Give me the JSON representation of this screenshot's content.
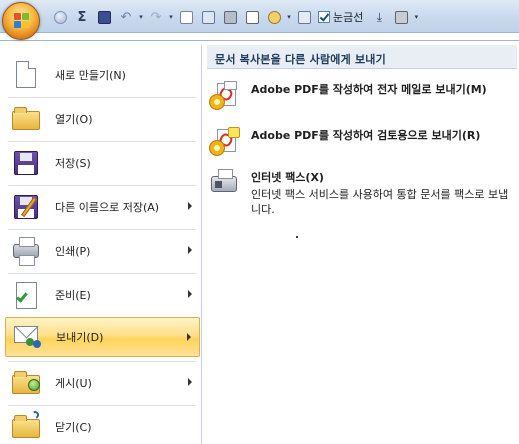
{
  "quick_access": {
    "check_label": "눈금선"
  },
  "menu": {
    "items": [
      {
        "label": "새로 만들기(N)",
        "icon": "new-document-icon"
      },
      {
        "label": "열기(O)",
        "icon": "open-folder-icon"
      },
      {
        "label": "저장(S)",
        "icon": "save-floppy-icon"
      },
      {
        "label": "다른 이름으로 저장(A)",
        "icon": "save-as-icon",
        "submenu": true
      },
      {
        "label": "인쇄(P)",
        "icon": "printer-icon",
        "submenu": true
      },
      {
        "label": "준비(E)",
        "icon": "prepare-icon",
        "submenu": true
      },
      {
        "label": "보내기(D)",
        "icon": "send-icon",
        "submenu": true,
        "active": true
      },
      {
        "label": "게시(U)",
        "icon": "publish-icon",
        "submenu": true
      },
      {
        "label": "닫기(C)",
        "icon": "close-folder-icon"
      }
    ]
  },
  "send_panel": {
    "title": "문서 복사본을 다른 사람에게 보내기",
    "options": [
      {
        "title": "Adobe PDF를 작성하여 전자 메일로 보내기(M)",
        "description": ""
      },
      {
        "title": "Adobe PDF를 작성하여 검토용으로 보내기(R)",
        "description": ""
      },
      {
        "title": "인터넷 팩스(X)",
        "description": "인터넷 팩스 서비스를 사용하여 통합 문서를 팩스로 보냅니다."
      }
    ]
  },
  "colors": {
    "active_highlight": "#ffd35a",
    "accent_text": "#1e395b"
  }
}
